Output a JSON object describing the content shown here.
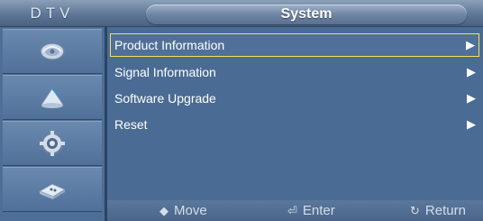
{
  "header": {
    "mode": "DTV",
    "title": "System"
  },
  "sidebar": {
    "items": [
      {
        "icon": "satellite-dish-icon"
      },
      {
        "icon": "channel-antenna-icon"
      },
      {
        "icon": "setup-gear-icon"
      },
      {
        "icon": "input-remote-icon"
      }
    ]
  },
  "menu": {
    "items": [
      {
        "label": "Product Information",
        "arrow": "▶",
        "selected": true
      },
      {
        "label": "Signal Information",
        "arrow": "▶",
        "selected": false
      },
      {
        "label": "Software Upgrade",
        "arrow": "▶",
        "selected": false
      },
      {
        "label": "Reset",
        "arrow": "▶",
        "selected": false
      }
    ]
  },
  "footer": {
    "move_icon": "◆",
    "move_label": "Move",
    "enter_icon": "⏎",
    "enter_label": "Enter",
    "return_icon": "↻",
    "return_label": "Return"
  },
  "colors": {
    "background": "#4a6b93",
    "selection_border": "#f2e45a",
    "text": "#ffffff"
  }
}
